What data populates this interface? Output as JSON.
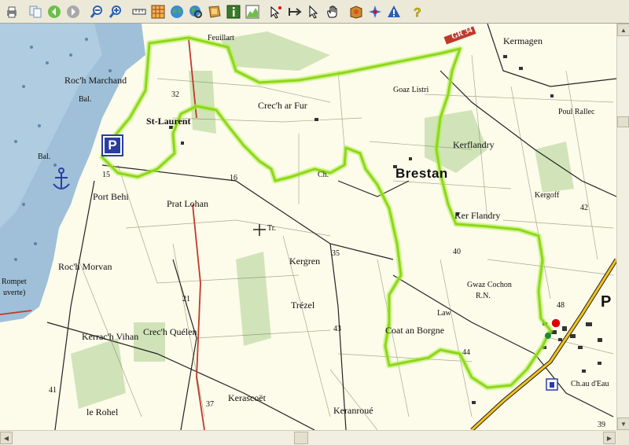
{
  "toolbar": {
    "buttons": [
      {
        "icon": "print-icon"
      },
      {
        "icon": "copy-icon"
      },
      {
        "icon": "back-icon"
      },
      {
        "icon": "forward-icon"
      },
      {
        "icon": "zoom-out-icon"
      },
      {
        "icon": "zoom-in-icon"
      },
      {
        "icon": "scale-ruler-icon"
      },
      {
        "icon": "grid-icon"
      },
      {
        "icon": "globe-icon"
      },
      {
        "icon": "globe-search-icon"
      },
      {
        "icon": "layers-icon"
      },
      {
        "icon": "info-icon"
      },
      {
        "icon": "profile-chart-icon"
      },
      {
        "icon": "select-point-icon"
      },
      {
        "icon": "measure-icon"
      },
      {
        "icon": "pointer-icon"
      },
      {
        "icon": "hand-pan-icon"
      },
      {
        "icon": "map-package-icon"
      },
      {
        "icon": "compass-rose-icon"
      },
      {
        "icon": "warning-icon"
      },
      {
        "icon": "help-icon"
      }
    ]
  },
  "map": {
    "labels": {
      "roc_h_marchand": "Roc'h Marchand",
      "bal_1": "Bal.",
      "st_laurent": "St-Laurent",
      "bal_2": "Bal.",
      "port_behi": "Port Behi",
      "prat_lohan": "Prat Lohan",
      "roch_morvan": "Roc'h Morvan",
      "rompet": "Rompet",
      "ouverte": "uverte)",
      "kerrac_h_vihan": "Kerrac'h Vihan",
      "crech_quelen": "Crec'h Quélen",
      "kerascoet": "Kerascoët",
      "le_rohel": "le Rohel",
      "crech_ar_fur": "Crec'h ar Fur",
      "feuillart": "Feuillart",
      "kermagen": "Kermagen",
      "goaz_listri": "Goaz Listri",
      "brestan": "Brestan",
      "kerflandry": "Kerflandry",
      "ker_flandry": "Ker Flandry",
      "poul_rallec": "Poul Rallec",
      "kergoff": "Kergoff",
      "kergren": "Kergren",
      "trezel": "Trézel",
      "coat_an_borgne": "Coat an Borgne",
      "goaz_cochon": "Gwaz Cochon",
      "rn": "R.N.",
      "keranroue": "Keranroué",
      "chau_d_eau": "Ch.au d'Eau",
      "ph": "P",
      "gr34": "GR 34",
      "law": "Law",
      "tr": "Tr.",
      "chu": "Ch.",
      "n32": "32",
      "n16": "16",
      "n35": "35",
      "n40": "40",
      "n43": "43",
      "n21": "21",
      "n37": "37",
      "n41": "41",
      "n48": "48",
      "n44": "44",
      "n39": "39",
      "n42": "42",
      "n15": "15"
    },
    "parking_label": "P",
    "colors": {
      "sea": "#9fc0d8",
      "land": "#fdfbea",
      "route": "#9be51a",
      "road_red": "#c0392b",
      "road_yellow": "#f4c31a",
      "wood": "#c9dfb0",
      "start_point": "#e00000"
    }
  },
  "scrollbars": {
    "vertical_position": 0.24,
    "horizontal_position": 0.48
  }
}
